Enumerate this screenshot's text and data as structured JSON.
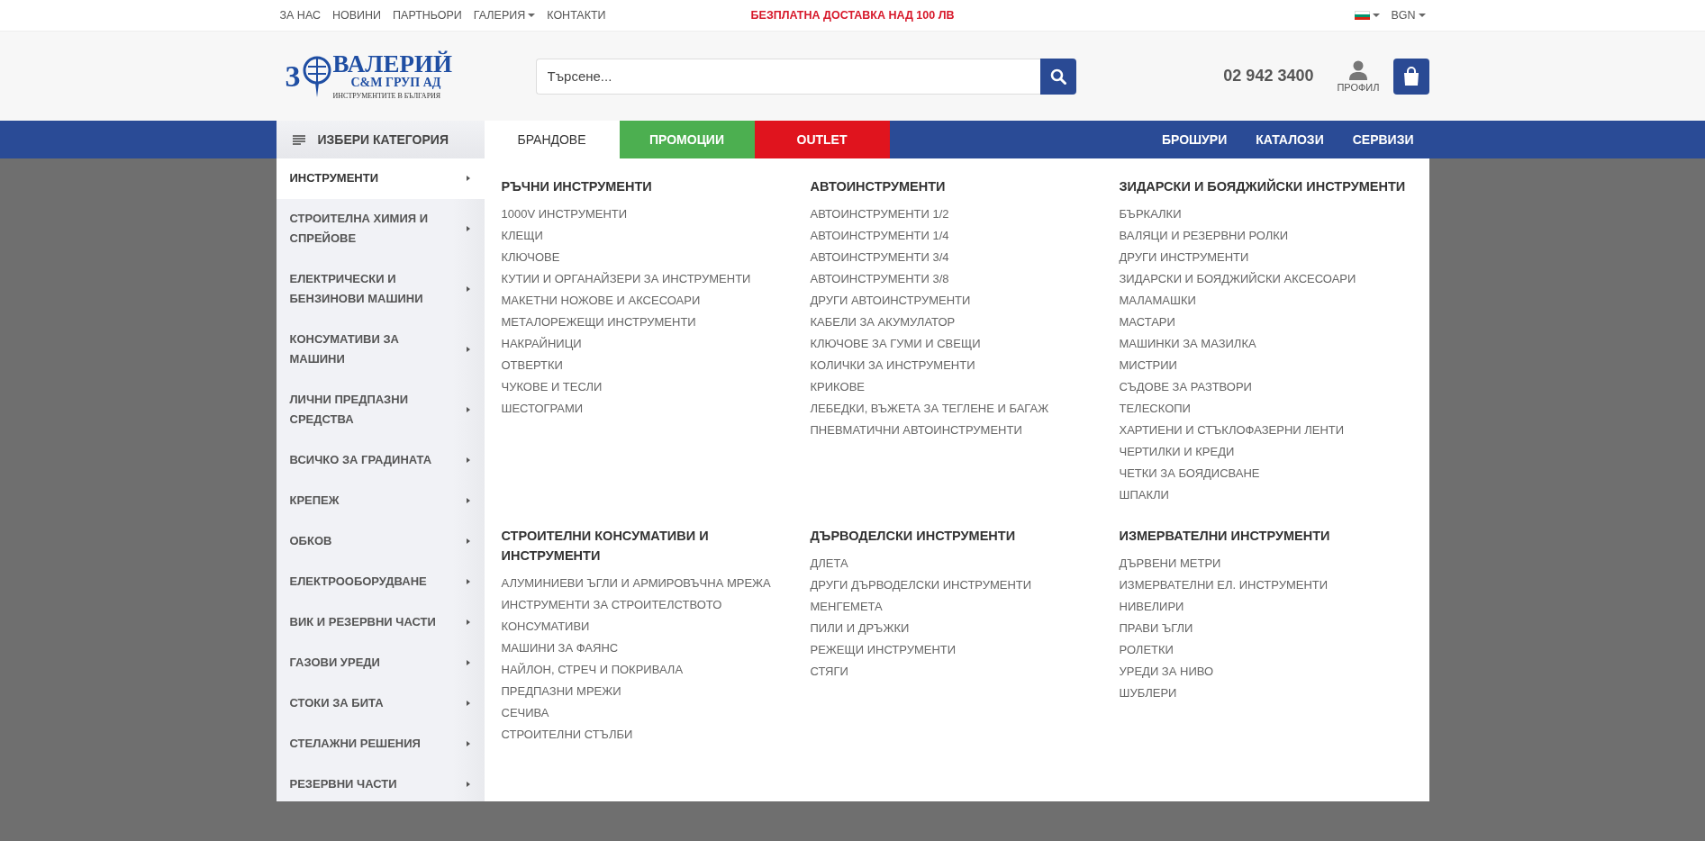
{
  "top_bar": {
    "links": [
      {
        "label": "ЗА НАС",
        "dropdown": false
      },
      {
        "label": "НОВИНИ",
        "dropdown": false
      },
      {
        "label": "ПАРТНЬОРИ",
        "dropdown": false
      },
      {
        "label": "ГАЛЕРИЯ",
        "dropdown": true
      },
      {
        "label": "КОНТАКТИ",
        "dropdown": false
      }
    ],
    "promo": "БЕЗПЛАТНА ДОСТАВКА НАД 100 ЛВ",
    "currency": "BGN"
  },
  "header": {
    "logo": {
      "mark": "3",
      "name": "ВАЛЕРИЙ",
      "subtitle": "С&М ГРУП АД",
      "tagline": "ИНСТРУМЕНТИТЕ В БЪЛГАРИЯ"
    },
    "search": {
      "placeholder": "Търсене..."
    },
    "phone": "02 942 3400",
    "profile": "ПРОФИЛ"
  },
  "nav": {
    "category_button": "ИЗБЕРИ КАТЕГОРИЯ",
    "tabs": [
      {
        "label": "БРАНДОВЕ",
        "color": "#ffffff"
      },
      {
        "label": "ПРОМОЦИИ",
        "color": "#4caf50"
      },
      {
        "label": "OUTLET",
        "color": "#e0141e"
      }
    ],
    "links": [
      "БРОШУРИ",
      "КАТАЛОЗИ",
      "СЕРВИЗИ"
    ]
  },
  "menu": {
    "categories": [
      {
        "label": "ИНСТРУМЕНТИ",
        "selected": true
      },
      {
        "label": "СТРОИТЕЛНА ХИМИЯ И СПРЕЙОВЕ",
        "selected": false
      },
      {
        "label": "ЕЛЕКТРИЧЕСКИ И БЕНЗИНОВИ МАШИНИ",
        "selected": false
      },
      {
        "label": "КОНСУМАТИВИ ЗА МАШИНИ",
        "selected": false
      },
      {
        "label": "ЛИЧНИ ПРЕДПАЗНИ СРЕДСТВА",
        "selected": false
      },
      {
        "label": "ВСИЧКО ЗА ГРАДИНАТА",
        "selected": false
      },
      {
        "label": "КРЕПЕЖ",
        "selected": false
      },
      {
        "label": "ОБКОВ",
        "selected": false
      },
      {
        "label": "ЕЛЕКТРООБОРУДВАНЕ",
        "selected": false
      },
      {
        "label": "ВИК И РЕЗЕРВНИ ЧАСТИ",
        "selected": false
      },
      {
        "label": "ГАЗОВИ УРЕДИ",
        "selected": false
      },
      {
        "label": "СТОКИ ЗА БИТА",
        "selected": false
      },
      {
        "label": "СТЕЛАЖНИ РЕШЕНИЯ",
        "selected": false
      },
      {
        "label": "РЕЗЕРВНИ ЧАСТИ",
        "selected": false
      }
    ],
    "groups": [
      {
        "title": "РЪЧНИ ИНСТРУМЕНТИ",
        "items": [
          "1000V ИНСТРУМЕНТИ",
          "КЛЕЩИ",
          "КЛЮЧОВЕ",
          "КУТИИ И ОРГАНАЙЗЕРИ ЗА ИНСТРУМЕНТИ",
          "МАКЕТНИ НОЖОВЕ И АКСЕСОАРИ",
          "МЕТАЛОРЕЖЕЩИ ИНСТРУМЕНТИ",
          "НАКРАЙНИЦИ",
          "ОТВЕРТКИ",
          "ЧУКОВЕ И ТЕСЛИ",
          "ШЕСТОГРАМИ"
        ]
      },
      {
        "title": "АВТОИНСТРУМЕНТИ",
        "items": [
          "АВТОИНСТРУМЕНТИ 1/2",
          "АВТОИНСТРУМЕНТИ 1/4",
          "АВТОИНСТРУМЕНТИ 3/4",
          "АВТОИНСТРУМЕНТИ 3/8",
          "ДРУГИ АВТОИНСТРУМЕНТИ",
          "КАБЕЛИ ЗА АКУМУЛАТОР",
          "КЛЮЧОВЕ ЗА ГУМИ И СВЕЩИ",
          "КОЛИЧКИ ЗА ИНСТРУМЕНТИ",
          "КРИКОВЕ",
          "ЛЕБЕДКИ, ВЪЖЕТА ЗА ТЕГЛЕНЕ И БАГАЖ",
          "ПНЕВМАТИЧНИ АВТОИНСТРУМЕНТИ"
        ]
      },
      {
        "title": "ЗИДАРСКИ И БОЯДЖИЙСКИ ИНСТРУМЕНТИ",
        "items": [
          "БЪРКАЛКИ",
          "ВАЛЯЦИ И РЕЗЕРВНИ РОЛКИ",
          "ДРУГИ ИНСТРУМЕНТИ",
          "ЗИДАРСКИ И БОЯДЖИЙСКИ АКСЕСОАРИ",
          "МАЛАМАШКИ",
          "МАСТАРИ",
          "МАШИНКИ ЗА МАЗИЛКА",
          "МИСТРИИ",
          "СЪДОВЕ ЗА РАЗТВОРИ",
          "ТЕЛЕСКОПИ",
          "ХАРТИЕНИ И СТЪКЛОФАЗЕРНИ ЛЕНТИ",
          "ЧЕРТИЛКИ И КРЕДИ",
          "ЧЕТКИ ЗА БОЯДИСВАНЕ",
          "ШПАКЛИ"
        ]
      },
      {
        "title": "СТРОИТЕЛНИ КОНСУМАТИВИ И ИНСТРУМЕНТИ",
        "items": [
          "АЛУМИНИЕВИ ЪГЛИ И АРМИРОВЪЧНА МРЕЖА",
          "ИНСТРУМЕНТИ ЗА СТРОИТЕЛСТВОТО",
          "КОНСУМАТИВИ",
          "МАШИНИ ЗА ФАЯНС",
          "НАЙЛОН, СТРЕЧ И ПОКРИВАЛА",
          "ПРЕДПАЗНИ МРЕЖИ",
          "СЕЧИВА",
          "СТРОИТЕЛНИ СТЪЛБИ"
        ]
      },
      {
        "title": "ДЪРВОДЕЛСКИ ИНСТРУМЕНТИ",
        "items": [
          "ДЛЕТА",
          "ДРУГИ ДЪРВОДЕЛСКИ ИНСТРУМЕНТИ",
          "МЕНГЕМЕТА",
          "ПИЛИ И ДРЪЖКИ",
          "РЕЖЕЩИ ИНСТРУМЕНТИ",
          "СТЯГИ"
        ]
      },
      {
        "title": "ИЗМЕРВАТЕЛНИ ИНСТРУМЕНТИ",
        "items": [
          "ДЪРВЕНИ МЕТРИ",
          "ИЗМЕРВАТЕЛНИ ЕЛ. ИНСТРУМЕНТИ",
          "НИВЕЛИРИ",
          "ПРАВИ ЪГЛИ",
          "РОЛЕТКИ",
          "УРЕДИ ЗА НИВО",
          "ШУБЛЕРИ"
        ]
      }
    ]
  }
}
